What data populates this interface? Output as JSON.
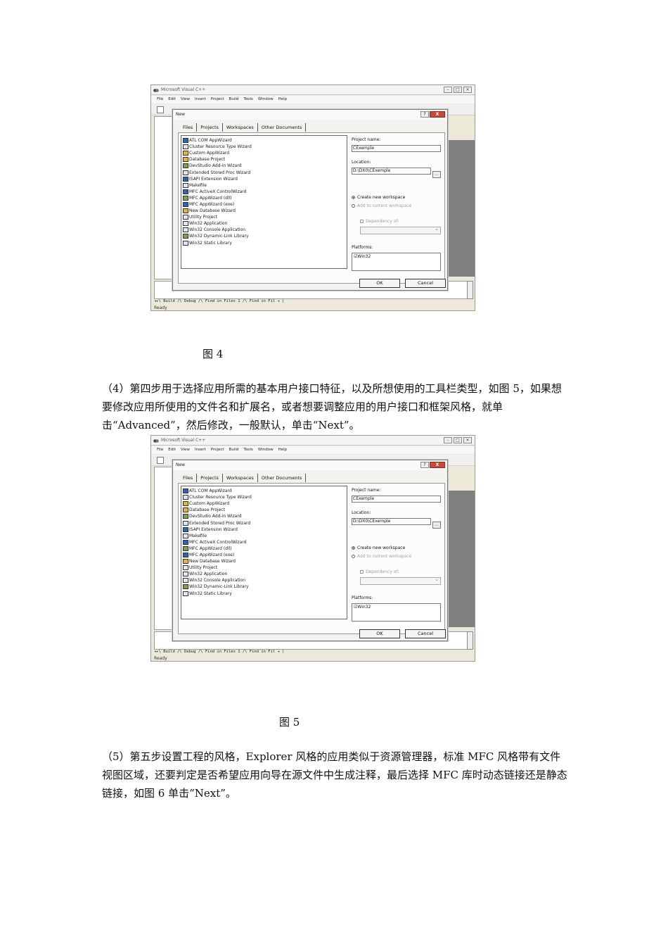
{
  "figures": [
    {
      "window_title": "Microsoft Visual C++",
      "menu": [
        "File",
        "Edit",
        "View",
        "Insert",
        "Project",
        "Build",
        "Tools",
        "Window",
        "Help"
      ],
      "bottom_tabs": "◂▸\\ Build /\\ Debug /\\ Find in Files 1 /\\ Find in Fil ◂ |",
      "status": "Ready",
      "dialog": {
        "title": "New",
        "help_btn": "?",
        "close_btn": "X",
        "tabs": [
          "Files",
          "Projects",
          "Workspaces",
          "Other Documents"
        ],
        "projects": [
          "ATL COM AppWizard",
          "Cluster Resource Type Wizard",
          "Custom AppWizard",
          "Database Project",
          "DevStudio Add-in Wizard",
          "Extended Stored Proc Wizard",
          "ISAPI Extension Wizard",
          "Makefile",
          "MFC ActiveX ControlWizard",
          "MFC AppWizard (dll)",
          "MFC AppWizard (exe)",
          "New Database Wizard",
          "Utility Project",
          "Win32 Application",
          "Win32 Console Application",
          "Win32 Dynamic-Link Library",
          "Win32 Static Library"
        ],
        "project_name_label": "Project name:",
        "project_name": "CExemple",
        "location_label": "Location:",
        "location": "D:\\DX0\\CExemple",
        "browse": "...",
        "create_ws": "Create new workspace",
        "add_ws": "Add to current workspace",
        "dependency": "Dependency of:",
        "platforms_label": "Platforms:",
        "platform": "Win32",
        "ok": "OK",
        "cancel": "Cancel"
      }
    },
    {
      "window_title": "Microsoft Visual C++",
      "menu": [
        "File",
        "Edit",
        "View",
        "Insert",
        "Project",
        "Build",
        "Tools",
        "Window",
        "Help"
      ],
      "bottom_tabs": "◂▸\\ Build /\\ Debug /\\ Find in Files 1 /\\ Find in Fil ◂ |",
      "status": "Ready",
      "dialog": {
        "title": "New",
        "help_btn": "?",
        "close_btn": "X",
        "tabs": [
          "Files",
          "Projects",
          "Workspaces",
          "Other Documents"
        ],
        "projects": [
          "ATL COM AppWizard",
          "Cluster Resource Type Wizard",
          "Custom AppWizard",
          "Database Project",
          "DevStudio Add-in Wizard",
          "Extended Stored Proc Wizard",
          "ISAPI Extension Wizard",
          "Makefile",
          "MFC ActiveX ControlWizard",
          "MFC AppWizard (dll)",
          "MFC AppWizard (exe)",
          "New Database Wizard",
          "Utility Project",
          "Win32 Application",
          "Win32 Console Application",
          "Win32 Dynamic-Link Library",
          "Win32 Static Library"
        ],
        "project_name_label": "Project name:",
        "project_name": "CExemple",
        "location_label": "Location:",
        "location": "D:\\DX0\\CExemple",
        "browse": "...",
        "create_ws": "Create new workspace",
        "add_ws": "Add to current workspace",
        "dependency": "Dependency of:",
        "platforms_label": "Platforms:",
        "platform": "Win32",
        "ok": "OK",
        "cancel": "Cancel"
      }
    }
  ],
  "caption1": "图 4",
  "paragraph1": "（4）第四步用于选择应用所需的基本用户接口特征，以及所想使用的工具栏类型，如图 5，如果想要修改应用所使用的文件名和扩展名，或者想要调整应用的用户接口和框架风格，就单击“Advanced”，然后修改，一般默认，单击“Next”。",
  "caption2": "图 5",
  "paragraph2": "（5）第五步设置工程的风格，Explorer 风格的应用类似于资源管理器，标准 MFC 风格带有文件视图区域，还要判定是否希望应用向导在源文件中生成注释，最后选择 MFC 库时动态链接还是静态链接，如图 6 单击“Next”。"
}
